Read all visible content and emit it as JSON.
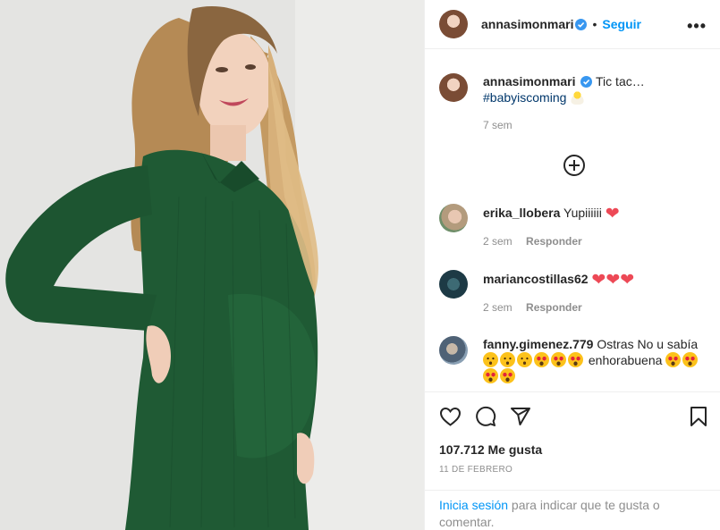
{
  "post": {
    "username": "annasimonmari",
    "follow_label": "Seguir",
    "separator": "•",
    "more_label": "•••"
  },
  "caption": {
    "username": "annasimonmari",
    "text": "Tic tac…",
    "hashtag": "#babyiscoming",
    "emoji": "hatching-chick",
    "time": "7 sem"
  },
  "comments": [
    {
      "username": "erika_llobera",
      "text": "Yupiiiiii",
      "emojis": [
        "red-heart"
      ],
      "time": "2 sem",
      "reply_label": "Responder"
    },
    {
      "username": "mariancostillas62",
      "text": "",
      "emojis": [
        "red-heart",
        "red-heart",
        "red-heart"
      ],
      "time": "2 sem",
      "reply_label": "Responder"
    },
    {
      "username": "fanny.gimenez.779",
      "text": "Ostras No u sabía",
      "text_after": "enhorabuena",
      "emojis": [
        "astonished-face",
        "astonished-face",
        "astonished-face",
        "heart-eyes",
        "heart-eyes",
        "heart-eyes",
        "heart-eyes",
        "heart-eyes",
        "heart-eyes",
        "heart-eyes"
      ]
    }
  ],
  "actions": {
    "like_icon": "heart-outline-icon",
    "comment_icon": "comment-icon",
    "share_icon": "paper-plane-icon",
    "save_icon": "bookmark-icon"
  },
  "likes_label": "107.712 Me gusta",
  "date_label": "11 DE FEBRERO",
  "login": {
    "link": "Inicia sesión",
    "text": " para indicar que te gusta o comentar."
  },
  "colors": {
    "link_blue": "#0095f6",
    "hashtag_blue": "#00376b",
    "heart_red": "#ed4956",
    "verified_blue": "#3897f0",
    "dress_green": "#1f5a34"
  }
}
